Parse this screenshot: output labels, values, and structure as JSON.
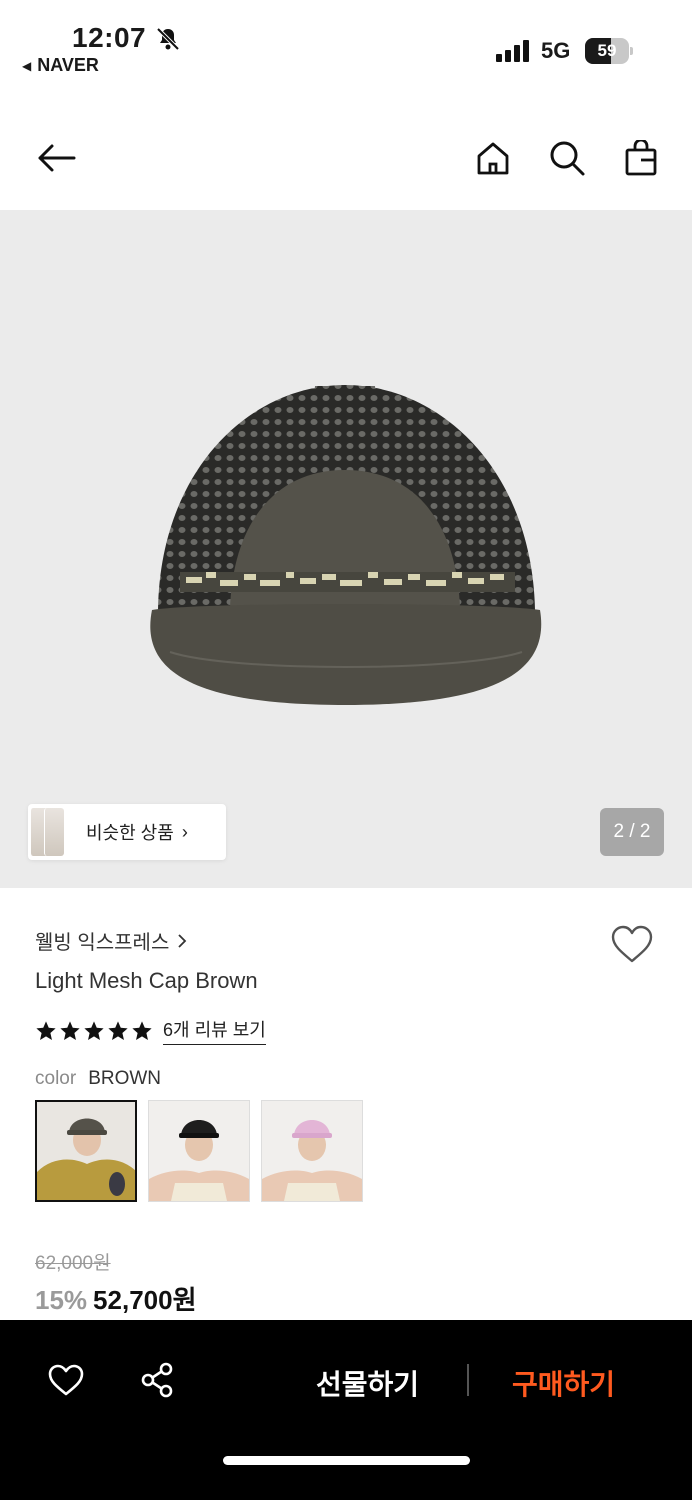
{
  "status_bar": {
    "time": "12:07",
    "back_app": "NAVER",
    "network": "5G",
    "battery": "59",
    "battery_level": 0.59
  },
  "nav": {
    "icons": [
      "back-arrow-icon",
      "home-icon",
      "search-icon",
      "shopping-bag-icon"
    ]
  },
  "gallery": {
    "similar_label": "비슷한 상품",
    "pager": "2 / 2",
    "background": "#ebebeb"
  },
  "product": {
    "brand": "웰빙 익스프레스",
    "name": "Light Mesh Cap Brown",
    "rating_stars": 5,
    "reviews_link": "6개 리뷰 보기",
    "color_label": "color",
    "color_value": "BROWN",
    "swatches": [
      "brown",
      "black",
      "pink"
    ],
    "original_price": "62,000원",
    "discount": "15%",
    "price": "52,700원"
  },
  "bottom_bar": {
    "gift_label": "선물하기",
    "buy_label": "구매하기",
    "buy_color": "#ff5a1f"
  }
}
